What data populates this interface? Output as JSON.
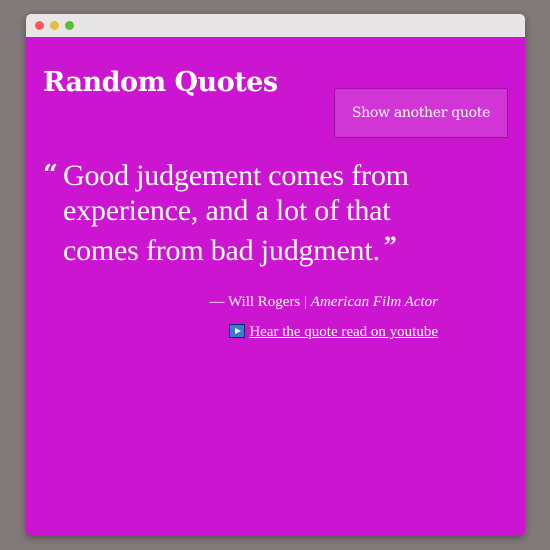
{
  "app": {
    "title": "Random Quotes",
    "new_quote_label": "Show another quote"
  },
  "quote": {
    "open_mark": "“",
    "text": "Good judgement comes from experience, and a lot of that comes from bad judgment.",
    "close_mark": "”",
    "dash": "—",
    "author": "Will Rogers",
    "separator": "|",
    "role": "American Film Actor"
  },
  "link": {
    "icon": "youtube-play-icon",
    "label": "Hear the quote read on youtube"
  },
  "colors": {
    "page_background": "#827a79",
    "app_background": "#cb15d0",
    "button_background": "#d135d6",
    "text": "#ffffff"
  }
}
